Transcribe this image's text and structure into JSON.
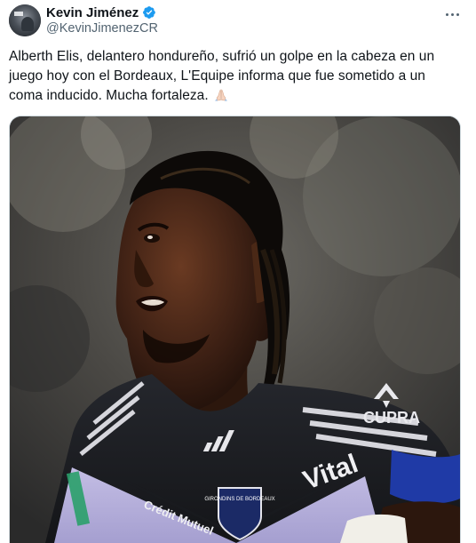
{
  "author": {
    "display_name": "Kevin Jiménez",
    "handle": "@KevinJimenezCR",
    "verified": true,
    "verified_color": "#1d9bf0"
  },
  "tweet": {
    "text_lines": [
      "Alberth Elis, delantero hondureño, sufrió un golpe en la cabeza en un",
      "juego hoy con el Bordeaux, L'Equipe informa que fue sometido a un",
      "coma inducido. Mucha fortaleza."
    ],
    "emoji": "pray-hands-icon"
  },
  "media": {
    "jersey_text": {
      "sponsor": "Vital",
      "brand": "CUPRA",
      "club_badge": "GIRONDINS DE BORDEAUX",
      "chest_left": "Crédit Mutuel"
    }
  },
  "icons": {
    "more": "more-options-icon"
  }
}
